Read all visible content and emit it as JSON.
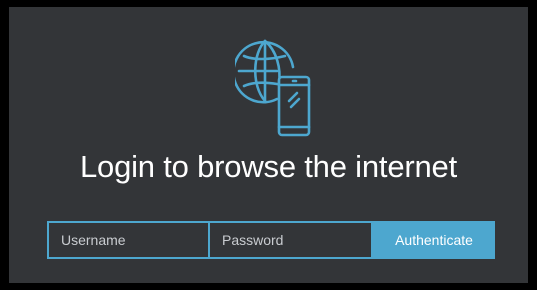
{
  "icon": "globe-mobile-icon",
  "title": "Login to browse the internet",
  "form": {
    "username_placeholder": "Username",
    "password_placeholder": "Password",
    "submit_label": "Authenticate"
  },
  "colors": {
    "background": "#333538",
    "accent": "#4da7cf",
    "text": "#ffffff"
  }
}
